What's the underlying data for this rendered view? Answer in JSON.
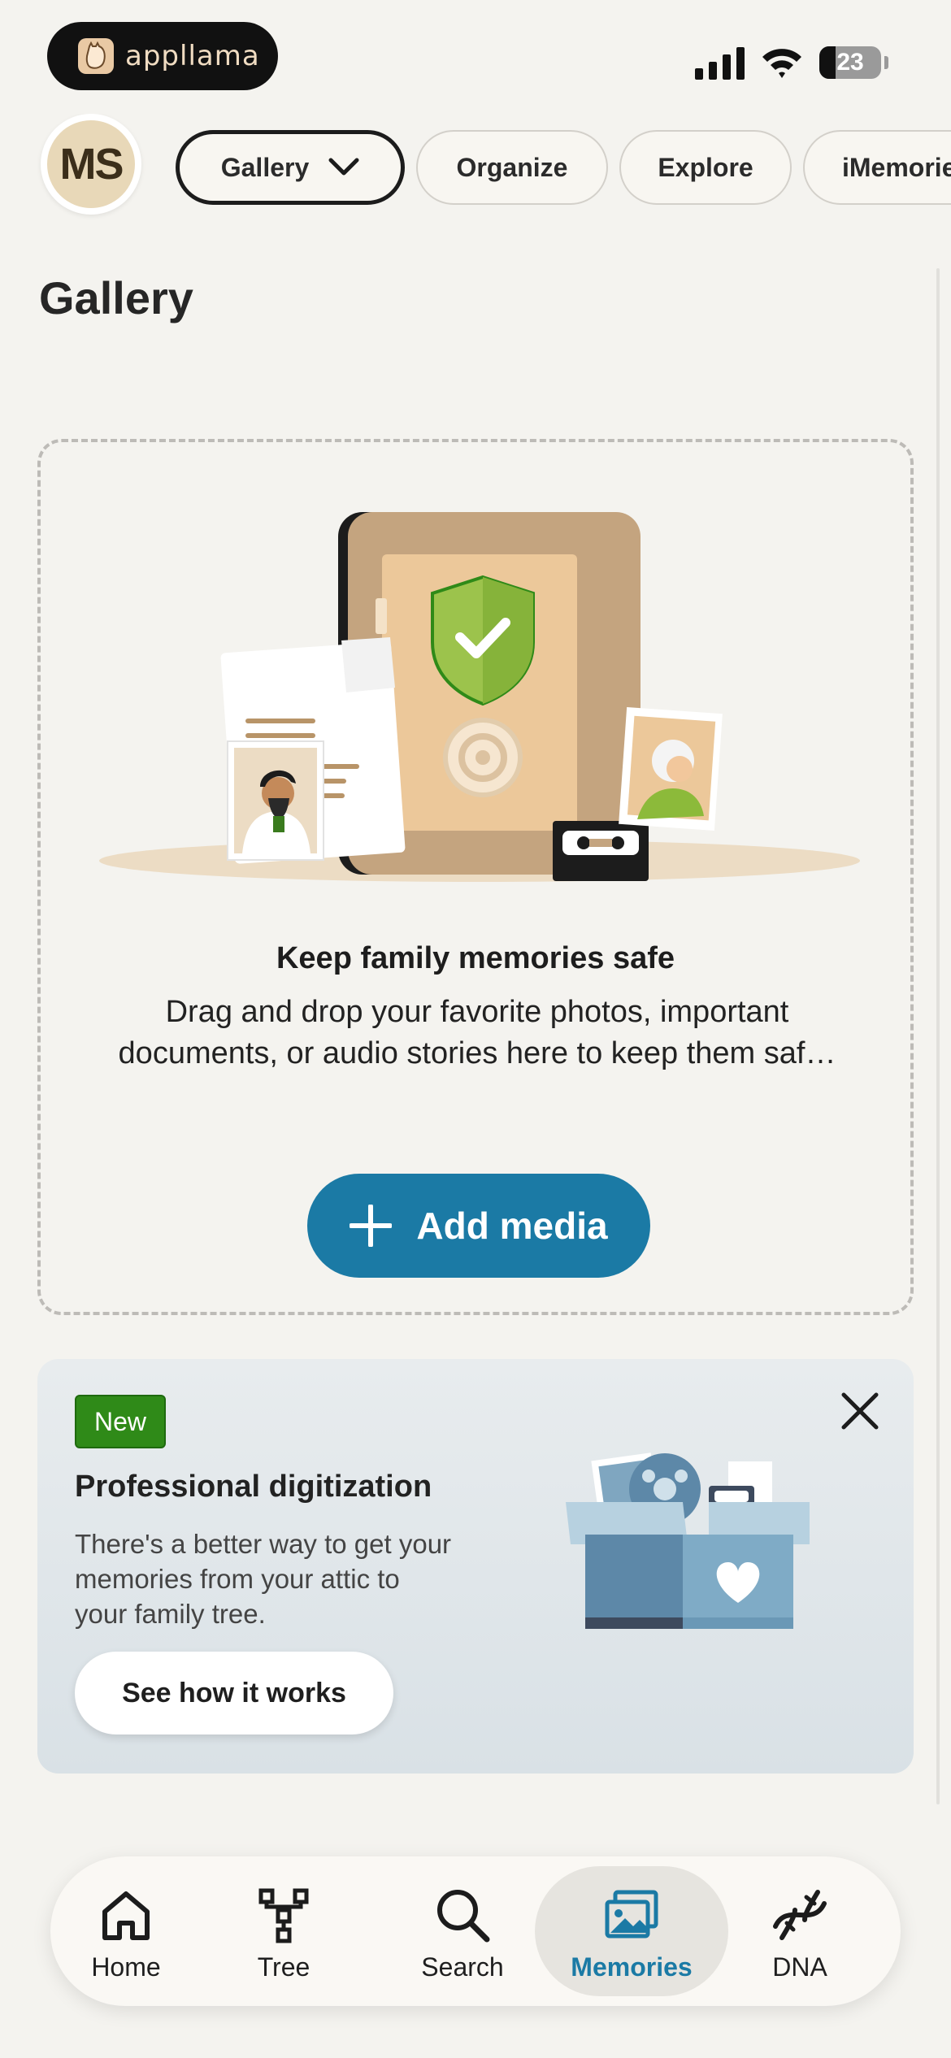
{
  "status_bar": {
    "app_name": "appllama",
    "battery": "23"
  },
  "top_nav": {
    "avatar_initials": "MS",
    "tabs": [
      {
        "label": "Gallery",
        "active": true
      },
      {
        "label": "Organize"
      },
      {
        "label": "Explore"
      },
      {
        "label": "iMemories"
      }
    ]
  },
  "page": {
    "title": "Gallery"
  },
  "dropzone": {
    "heading": "Keep family memories safe",
    "body": "Drag and drop your favorite photos, important documents, or audio stories here to keep them saf…",
    "button_label": "Add media"
  },
  "promo": {
    "badge": "New",
    "title": "Professional digitization",
    "body": "There's a better way to get your memories from your attic to your family tree.",
    "button_label": "See how it works"
  },
  "bottom_nav": {
    "items": [
      {
        "label": "Home",
        "icon": "home-icon"
      },
      {
        "label": "Tree",
        "icon": "tree-icon"
      },
      {
        "label": "Search",
        "icon": "search-icon"
      },
      {
        "label": "Memories",
        "icon": "memories-icon",
        "active": true
      },
      {
        "label": "DNA",
        "icon": "dna-icon"
      }
    ]
  },
  "colors": {
    "accent": "#1b7aa5",
    "new_badge": "#2f8a18",
    "background": "#f4f3ef"
  }
}
